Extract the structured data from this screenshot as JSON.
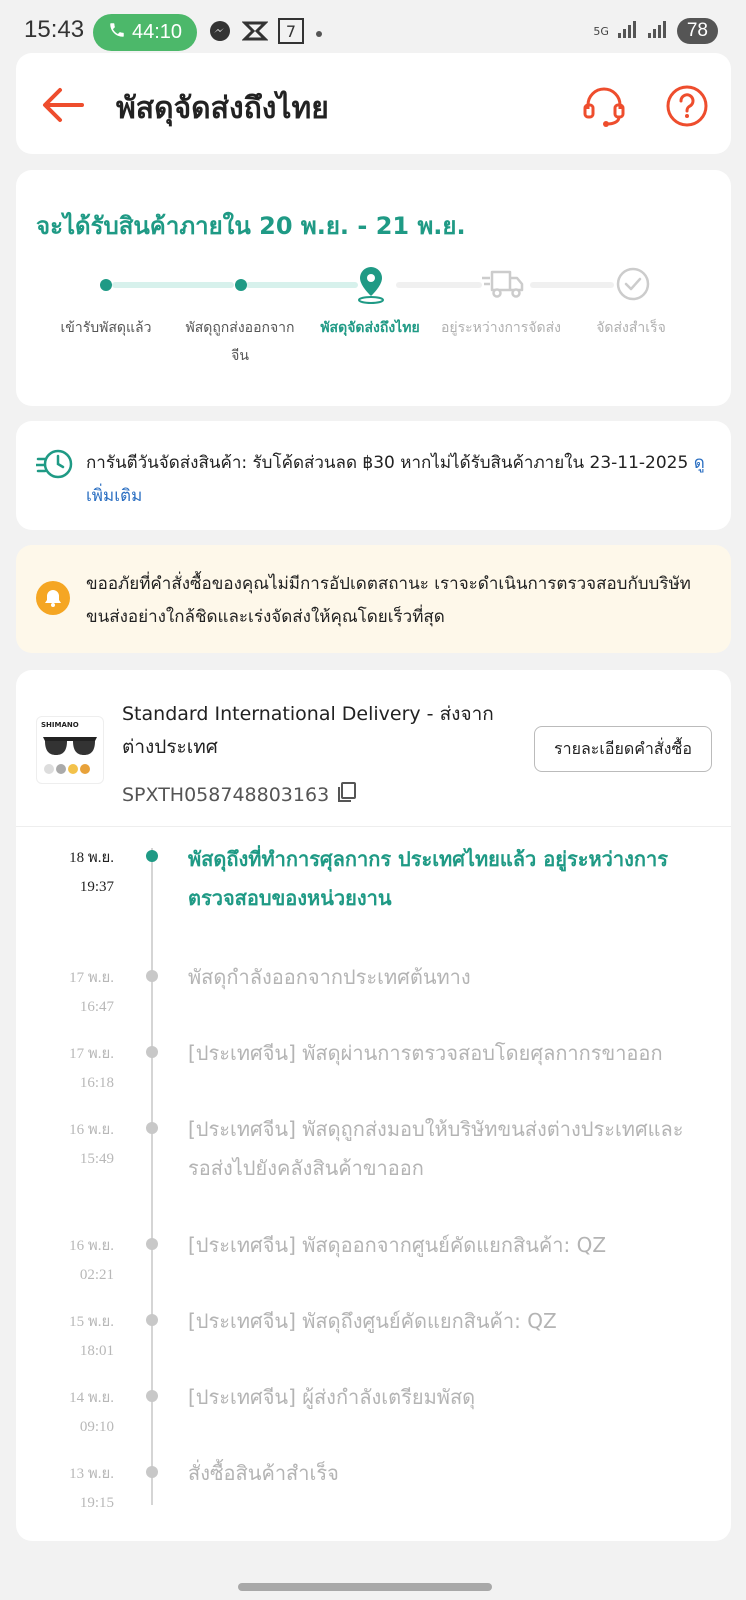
{
  "status_bar": {
    "time": "15:43",
    "call_duration": "44:10",
    "network": "5G",
    "battery": "78"
  },
  "header": {
    "title": "พัสดุจัดส่งถึงไทย",
    "icons": [
      "back-arrow-icon",
      "headset-icon",
      "help-icon"
    ]
  },
  "delivery": {
    "eta": "จะได้รับสินค้าภายใน 20 พ.ย. - 21 พ.ย.",
    "steps": [
      {
        "label": "เข้ารับพัสดุแล้ว",
        "state": "done"
      },
      {
        "label": "พัสดุถูกส่งออกจากจีน",
        "state": "done"
      },
      {
        "label": "พัสดุจัดส่งถึงไทย",
        "state": "active"
      },
      {
        "label": "อยู่ระหว่างการจัดส่ง",
        "state": "future"
      },
      {
        "label": "จัดส่งสำเร็จ",
        "state": "future"
      }
    ]
  },
  "guarantee": {
    "text": "การันตีวันจัดส่งสินค้า: รับโค้ดส่วนลด ฿30 หากไม่ได้รับสินค้าภายใน 23-11-2025",
    "link": "ดูเพิ่มเติม"
  },
  "notice": {
    "text": "ขออภัยที่คำสั่งซื้อของคุณไม่มีการอัปเดตสถานะ เราจะดำเนินการตรวจสอบกับบริษัทขนส่งอย่างใกล้ชิดและเร่งจัดส่งให้คุณโดยเร็วที่สุด"
  },
  "shipment": {
    "product_brand": "SHIMANO",
    "method": "Standard International Delivery - ส่งจากต่างประเทศ",
    "tracking_number": "SPXTH058748803163",
    "order_details_button": "รายละเอียดคำสั่งซื้อ"
  },
  "timeline": [
    {
      "date": "18 พ.ย.",
      "time": "19:37",
      "text": "พัสดุถึงที่ทำการศุลกากร ประเทศไทยแล้ว อยู่ระหว่างการตรวจสอบของหน่วยงาน",
      "current": true
    },
    {
      "date": "17 พ.ย.",
      "time": "16:47",
      "text": "พัสดุกำลังออกจากประเทศต้นทาง",
      "current": false
    },
    {
      "date": "17 พ.ย.",
      "time": "16:18",
      "text": "[ประเทศจีน] พัสดุผ่านการตรวจสอบโดยศุลกากรขาออก",
      "current": false
    },
    {
      "date": "16 พ.ย.",
      "time": "15:49",
      "text": "[ประเทศจีน] พัสดุถูกส่งมอบให้บริษัทขนส่งต่างประเทศและรอส่งไปยังคลังสินค้าขาออก",
      "current": false
    },
    {
      "date": "16 พ.ย.",
      "time": "02:21",
      "text": "[ประเทศจีน] พัสดุออกจากศูนย์คัดแยกสินค้า: QZ",
      "current": false
    },
    {
      "date": "15 พ.ย.",
      "time": "18:01",
      "text": "[ประเทศจีน] พัสดุถึงศูนย์คัดแยกสินค้า: QZ",
      "current": false
    },
    {
      "date": "14 พ.ย.",
      "time": "09:10",
      "text": "[ประเทศจีน] ผู้ส่งกำลังเตรียมพัสดุ",
      "current": false
    },
    {
      "date": "13 พ.ย.",
      "time": "19:15",
      "text": "สั่งซื้อสินค้าสำเร็จ",
      "current": false
    }
  ],
  "colors": {
    "accent": "#ee4d2d",
    "teal": "#1f9a85",
    "link": "#2b6fc2",
    "notice_bg": "#fef8ea",
    "bell": "#f5a623",
    "call_green": "#4cb86a"
  }
}
